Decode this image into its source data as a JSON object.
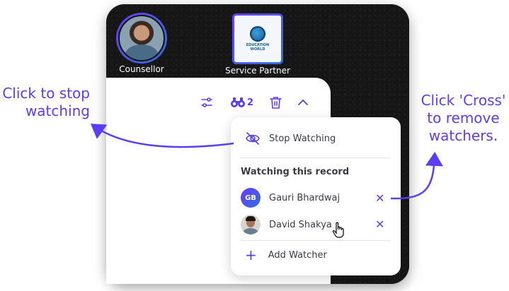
{
  "profile": {
    "counsellor_label": "Counsellor",
    "partner_label": "Service Partner",
    "partner_logo_text": "EDUCATION WORLD"
  },
  "toolbar": {
    "watcher_count": "2"
  },
  "watch_menu": {
    "stop_watching_label": "Stop Watching",
    "section_heading": "Watching this record",
    "watchers": [
      {
        "initials": "GB",
        "name": "Gauri Bhardwaj"
      },
      {
        "initials": "",
        "name": "David Shakya"
      }
    ],
    "add_watcher_label": "Add Watcher"
  },
  "annotations": {
    "left_line1": "Click to stop",
    "left_line2": "watching",
    "right_line1": "Click 'Cross'",
    "right_line2": "to remove",
    "right_line3": "watchers."
  },
  "colors": {
    "accent": "#5b3df5",
    "background_dark": "#161616"
  }
}
